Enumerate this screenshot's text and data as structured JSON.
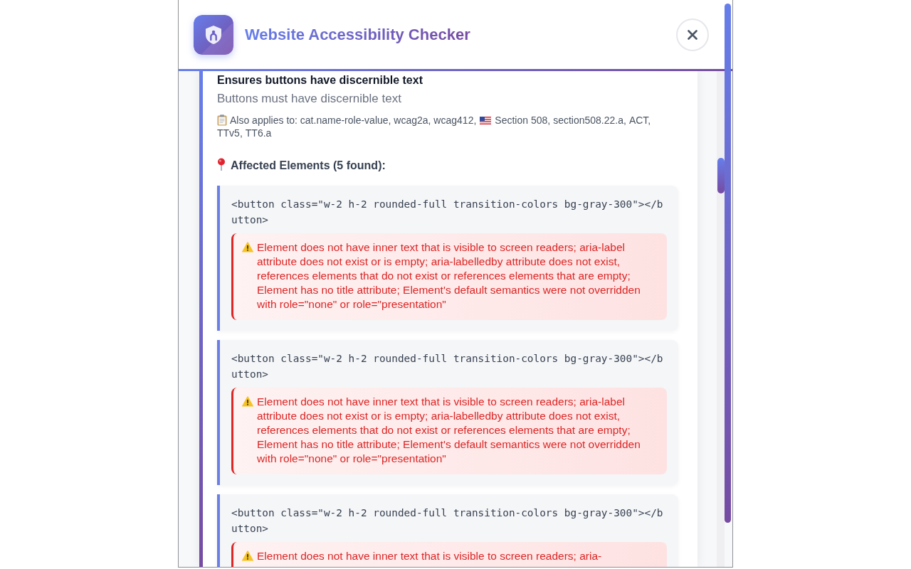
{
  "header": {
    "title": "Website Accessibility Checker"
  },
  "rule": {
    "heading": "Ensures buttons have discernible text",
    "description": "Buttons must have discernible text",
    "applies_to": {
      "text": "Also applies to: cat.name-role-value, wcag2a, wcag412,",
      "standards": [
        "Section 508,",
        "section508.22.a,",
        "ACT,",
        "TTv5,",
        "TT6.a"
      ]
    },
    "affected_heading": "Affected Elements (5 found):",
    "elements": [
      {
        "code": "<button class=\"w-2 h-2 rounded-full transition-colors bg-gray-300\"></button>",
        "message": "Element does not have inner text that is visible to screen readers; aria-label attribute does not exist or is empty; aria-labelledby attribute does not exist, references elements that do not exist or references elements that are empty; Element has no title attribute; Element's default semantics were not overridden with role=\"none\" or role=\"presentation\""
      },
      {
        "code": "<button class=\"w-2 h-2 rounded-full transition-colors bg-gray-300\"></button>",
        "message": "Element does not have inner text that is visible to screen readers; aria-label attribute does not exist or is empty; aria-labelledby attribute does not exist, references elements that do not exist or references elements that are empty; Element has no title attribute; Element's default semantics were not overridden with role=\"none\" or role=\"presentation\""
      },
      {
        "code": "<button class=\"w-2 h-2 rounded-full transition-colors bg-gray-300\"></button>",
        "message": "Element does not have inner text that is visible to screen readers; aria-"
      }
    ]
  }
}
